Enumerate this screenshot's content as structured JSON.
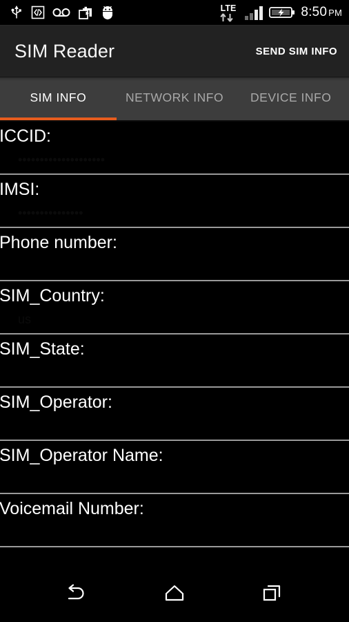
{
  "status_bar": {
    "left_icons": [
      {
        "name": "usb-icon",
        "label": "USB"
      },
      {
        "name": "developer-mode-icon",
        "label": "</>"
      },
      {
        "name": "voicemail-icon",
        "label": "Voicemail"
      },
      {
        "name": "screen-recorder-icon",
        "label": "Screen recorder"
      },
      {
        "name": "android-debug-icon",
        "label": "Android"
      }
    ],
    "network_type": "LTE",
    "signal_bars": 4,
    "signal_filled": 2,
    "battery_charging": true,
    "time": "8:50",
    "am_pm": "PM"
  },
  "app_bar": {
    "title": "SIM Reader",
    "action_label": "SEND SIM INFO"
  },
  "tabs": {
    "active_index": 0,
    "items": [
      {
        "label": "SIM INFO"
      },
      {
        "label": "NETWORK INFO"
      },
      {
        "label": "DEVICE INFO"
      }
    ],
    "indicator_color": "#e65c1e"
  },
  "sim_info": {
    "rows": [
      {
        "label": "ICCID:",
        "value": "••••••••••••••••••••"
      },
      {
        "label": "IMSI:",
        "value": "•••••••••••••••"
      },
      {
        "label": "Phone number:",
        "value": ""
      },
      {
        "label": "SIM_Country:",
        "value": "us"
      },
      {
        "label": "SIM_State:",
        "value": ""
      },
      {
        "label": "SIM_Operator:",
        "value": ""
      },
      {
        "label": "SIM_Operator Name:",
        "value": ""
      },
      {
        "label": "Voicemail Number:",
        "value": ""
      }
    ]
  },
  "nav_bar": {
    "buttons": [
      {
        "name": "back-button",
        "label": "Back"
      },
      {
        "name": "home-button",
        "label": "Home"
      },
      {
        "name": "recents-button",
        "label": "Recent apps"
      }
    ]
  },
  "colors": {
    "app_bar_bg": "#222222",
    "tab_bar_bg": "#3d3d3d",
    "accent": "#e65c1e",
    "divider": "#9a9a9a",
    "background": "#000000"
  }
}
